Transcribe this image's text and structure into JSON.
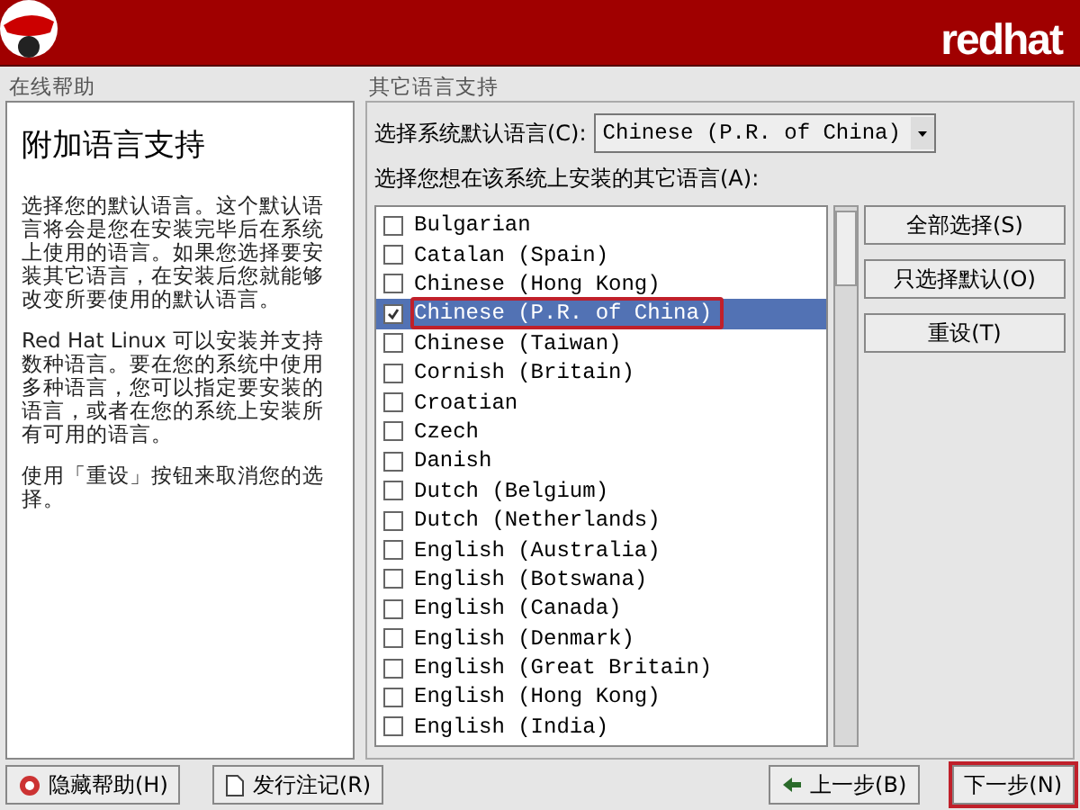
{
  "header": {
    "logo_text": "redhat"
  },
  "help": {
    "label": "在线帮助",
    "title": "附加语言支持",
    "paragraphs": [
      "选择您的默认语言。这个默认语言将会是您在安装完毕后在系统上使用的语言。如果您选择要安装其它语言，在安装后您就能够改变所要使用的默认语言。",
      "Red Hat Linux 可以安装并支持数种语言。要在您的系统中使用多种语言，您可以指定要安装的语言，或者在您的系统上安装所有可用的语言。",
      "使用「重设」按钮来取消您的选择。"
    ]
  },
  "languages": {
    "label": "其它语言支持",
    "default_label": "选择系统默认语言(C):",
    "default_value": "Chinese (P.R. of China)",
    "list_label": "选择您想在该系统上安装的其它语言(A):",
    "items": [
      {
        "name": "Bulgarian",
        "checked": false,
        "selected": false,
        "highlighted": false
      },
      {
        "name": "Catalan (Spain)",
        "checked": false,
        "selected": false,
        "highlighted": false
      },
      {
        "name": "Chinese (Hong Kong)",
        "checked": false,
        "selected": false,
        "highlighted": false
      },
      {
        "name": "Chinese (P.R. of China)",
        "checked": true,
        "selected": true,
        "highlighted": true
      },
      {
        "name": "Chinese (Taiwan)",
        "checked": false,
        "selected": false,
        "highlighted": false
      },
      {
        "name": "Cornish (Britain)",
        "checked": false,
        "selected": false,
        "highlighted": false
      },
      {
        "name": "Croatian",
        "checked": false,
        "selected": false,
        "highlighted": false
      },
      {
        "name": "Czech",
        "checked": false,
        "selected": false,
        "highlighted": false
      },
      {
        "name": "Danish",
        "checked": false,
        "selected": false,
        "highlighted": false
      },
      {
        "name": "Dutch (Belgium)",
        "checked": false,
        "selected": false,
        "highlighted": false
      },
      {
        "name": "Dutch (Netherlands)",
        "checked": false,
        "selected": false,
        "highlighted": false
      },
      {
        "name": "English (Australia)",
        "checked": false,
        "selected": false,
        "highlighted": false
      },
      {
        "name": "English (Botswana)",
        "checked": false,
        "selected": false,
        "highlighted": false
      },
      {
        "name": "English (Canada)",
        "checked": false,
        "selected": false,
        "highlighted": false
      },
      {
        "name": "English (Denmark)",
        "checked": false,
        "selected": false,
        "highlighted": false
      },
      {
        "name": "English (Great Britain)",
        "checked": false,
        "selected": false,
        "highlighted": false
      },
      {
        "name": "English (Hong Kong)",
        "checked": false,
        "selected": false,
        "highlighted": false
      },
      {
        "name": "English (India)",
        "checked": false,
        "selected": false,
        "highlighted": false
      }
    ],
    "buttons": [
      "全部选择(S)",
      "只选择默认(O)",
      "重设(T)"
    ]
  },
  "footer": {
    "left_buttons": [
      {
        "label": "隐藏帮助(H)",
        "kind": "help"
      },
      {
        "label": "发行注记(R)",
        "kind": "notes"
      }
    ],
    "right_buttons": [
      {
        "label": "上一步(B)",
        "kind": "back",
        "highlighted": false
      },
      {
        "label": "下一步(N)",
        "kind": "next",
        "highlighted": true
      }
    ]
  }
}
